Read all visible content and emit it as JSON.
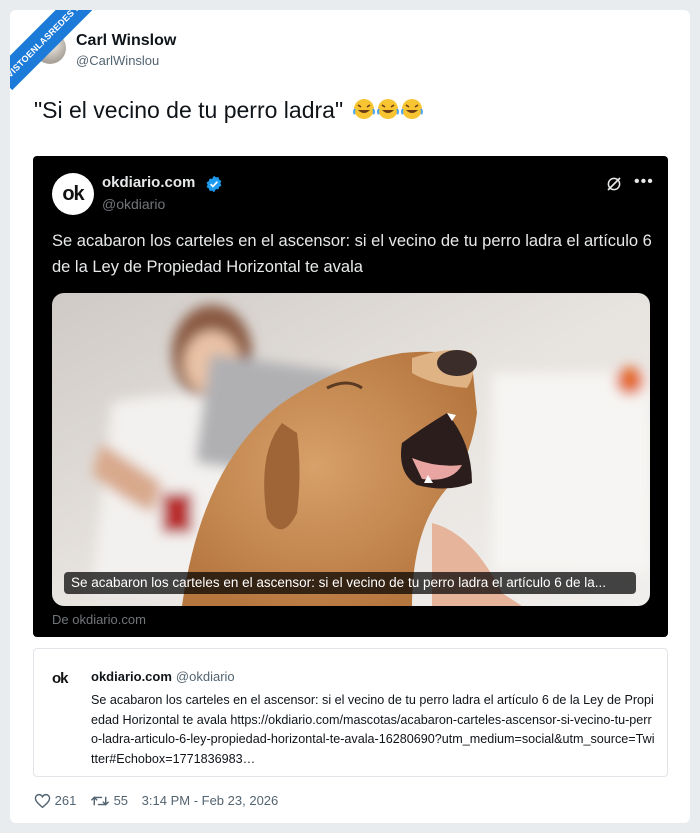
{
  "watermark": "VISTOENLASREDES .com",
  "author": {
    "name": "Carl Winslow",
    "handle": "@CarlWinslou"
  },
  "tweet": {
    "text": "\"Si el vecino de tu perro ladra\"",
    "emojis": "🤣🤣🤣"
  },
  "embedded_post": {
    "logo_text": "ok",
    "name": "okdiario.com",
    "handle": "@okdiario",
    "text": "Se acabaron los carteles en el ascensor: si el vecino de tu perro ladra el artículo 6 de la Ley de Propiedad Horizontal te avala",
    "media_caption": "Se acabaron los carteles en el ascensor: si el vecino de tu perro ladra el artículo 6 de la...",
    "source": "De okdiario.com"
  },
  "quoted_post": {
    "logo_text": "ok",
    "name": "okdiario.com",
    "handle": "@okdiario",
    "text": "Se acabaron los carteles en el ascensor: si el vecino de tu perro ladra el artículo 6 de la Ley de Propiedad Horizontal te avala https://okdiario.com/mascotas/acabaron-carteles-ascensor-si-vecino-tu-perro-ladra-articulo-6-ley-propiedad-horizontal-te-avala-16280690?utm_medium=social&utm_source=Twitter#Echobox=1771836983…"
  },
  "footer": {
    "likes": "261",
    "retweets": "55",
    "timestamp": "3:14 PM - Feb 23, 2026"
  },
  "colors": {
    "accent": "#1d9bf0",
    "watermark_bg": "#1c7bd8"
  }
}
